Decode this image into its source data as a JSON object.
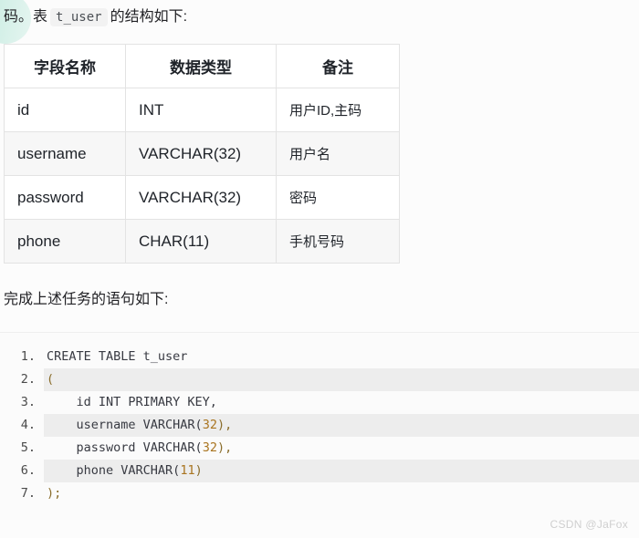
{
  "intro": {
    "before": "码。表",
    "code": "t_user",
    "after": "的结构如下:"
  },
  "table": {
    "headers": [
      "字段名称",
      "数据类型",
      "备注"
    ],
    "rows": [
      [
        "id",
        "INT",
        "用户ID,主码"
      ],
      [
        "username",
        "VARCHAR(32)",
        "用户名"
      ],
      [
        "password",
        "VARCHAR(32)",
        "密码"
      ],
      [
        "phone",
        "CHAR(11)",
        "手机号码"
      ]
    ]
  },
  "sub_heading": "完成上述任务的语句如下:",
  "code_block": {
    "language": "sql",
    "lines": [
      {
        "num": "1.",
        "text": "CREATE TABLE t_user"
      },
      {
        "num": "2.",
        "text": "("
      },
      {
        "num": "3.",
        "text": "    id INT PRIMARY KEY,"
      },
      {
        "num": "4.",
        "pre": "    username VARCHAR(",
        "num_token": "32",
        "post": "),"
      },
      {
        "num": "5.",
        "pre": "    password VARCHAR(",
        "num_token": "32",
        "post": "),"
      },
      {
        "num": "6.",
        "pre": "    phone VARCHAR(",
        "num_token": "11",
        "post": ")"
      },
      {
        "num": "7.",
        "text": ");"
      }
    ]
  },
  "watermark": "CSDN @JaFox",
  "colors": {
    "page_bg": "#fcfcfc",
    "code_bg": "#fbfbfb",
    "code_stripe": "#ededed",
    "table_border": "#e3e3e3",
    "table_stripe": "#f7f7f7",
    "number_token": "#a9741f",
    "blob": "#c9ece2",
    "watermark": "#cfcfcf"
  }
}
